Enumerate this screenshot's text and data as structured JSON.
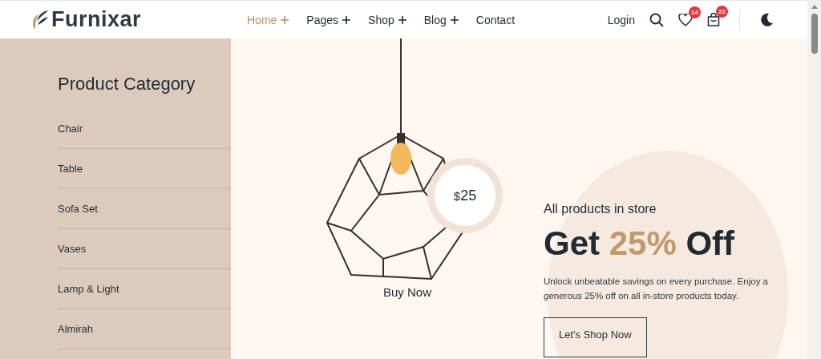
{
  "brand": {
    "name": "Furnixar"
  },
  "nav": [
    {
      "label": "Home",
      "selected": true
    },
    {
      "label": "Pages",
      "selected": false
    },
    {
      "label": "Shop",
      "selected": false
    },
    {
      "label": "Blog",
      "selected": false
    },
    {
      "label": "Contact",
      "selected": false,
      "has_submenu": false
    }
  ],
  "actions": {
    "login": "Login",
    "wishlist_count": "14",
    "cart_count": "22"
  },
  "sidebar": {
    "title": "Product Category",
    "items": [
      "Chair",
      "Table",
      "Sofa Set",
      "Vases",
      "Lamp & Light",
      "Almirah"
    ]
  },
  "hero": {
    "price_currency": "$",
    "price_value": "25",
    "buy_label": "Buy Now",
    "eyebrow": "All products in store",
    "headline_before": "Get",
    "headline_highlight": "25%",
    "headline_after": "Off",
    "description": "Unlock unbeatable savings on every purchase. Enjoy a generous 25% off on all in-store products today.",
    "cta": "Let's Shop Now"
  }
}
